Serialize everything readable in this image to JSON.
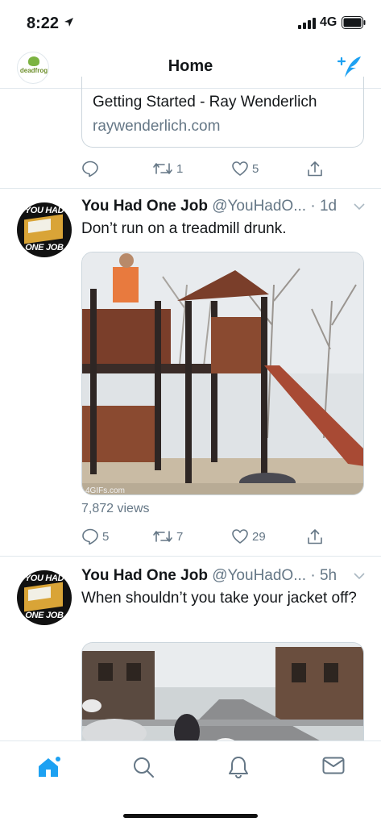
{
  "status": {
    "time": "8:22",
    "network": "4G"
  },
  "header": {
    "title": "Home",
    "brand": "deadfrog"
  },
  "link_card": {
    "title": "Getting Started - Ray Wenderlich",
    "domain": "raywenderlich.com"
  },
  "first_actions": {
    "reply": "",
    "retweets": "1",
    "likes": "5"
  },
  "tweets": [
    {
      "name": "You Had One Job",
      "handle": "@YouHadO...",
      "sep": " · ",
      "time": "1d",
      "text": "Don’t run on a treadmill drunk.",
      "gif_watermark": "4GIFs.com",
      "views": "7,872 views",
      "replies": "5",
      "retweets": "7",
      "likes": "29"
    },
    {
      "name": "You Had One Job",
      "handle": "@YouHadO...",
      "sep": " · ",
      "time": "5h",
      "text": "When shouldn’t you take your jacket off?"
    }
  ],
  "avatar_text": {
    "top": "YOU HAD",
    "bottom": "ONE JOB"
  },
  "colors": {
    "accent": "#1da1f2",
    "secondary": "#657786",
    "border": "#e1e8ed"
  },
  "tabs": [
    "home-icon",
    "search-icon",
    "notifications-icon",
    "messages-icon"
  ]
}
